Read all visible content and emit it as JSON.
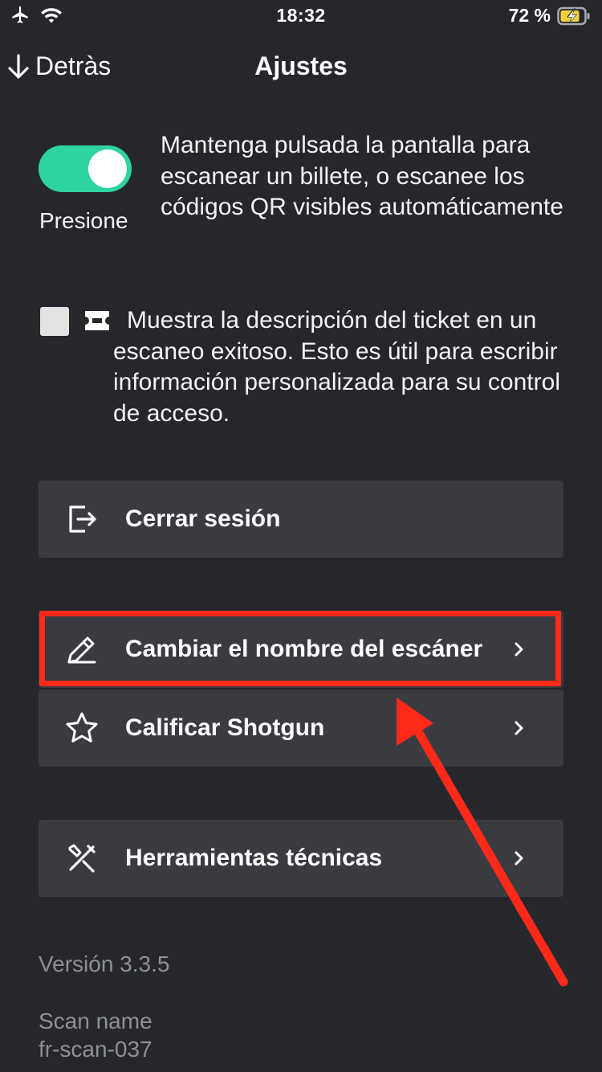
{
  "status_bar": {
    "time": "18:32",
    "battery_percent": "72 %",
    "icons": [
      "airplane-icon",
      "wifi-icon",
      "battery-charging-icon"
    ]
  },
  "nav": {
    "back_label": "Detràs",
    "title": "Ajustes"
  },
  "press_toggle": {
    "label": "Presione",
    "description": "Mantenga pulsada la pantalla para escanear un billete, o escanee los códigos QR visibles automáticamente",
    "state": "on"
  },
  "ticket_description_option": {
    "description": "Muestra la descripción del ticket en un escaneo exitoso. Esto es útil para escribir información personalizada para su control de acceso.",
    "checked": false
  },
  "menu": {
    "logout": {
      "label": "Cerrar sesión",
      "icon": "logout-icon"
    },
    "rename_scanner": {
      "label": "Cambiar el nombre del escáner",
      "icon": "pencil-icon"
    },
    "rate_shotgun": {
      "label": "Calificar Shotgun",
      "icon": "star-icon"
    },
    "technical_tools": {
      "label": "Herramientas técnicas",
      "icon": "tools-icon"
    }
  },
  "footer": {
    "version": "Versión 3.3.5",
    "scan_name_label": "Scan name",
    "scan_name_value": "fr-scan-037"
  },
  "colors": {
    "background": "#25272d",
    "row_background": "#393b41",
    "toggle_on": "#2dd4a0",
    "annotation_red": "#ff2a1a",
    "muted_text": "#8e9096"
  }
}
